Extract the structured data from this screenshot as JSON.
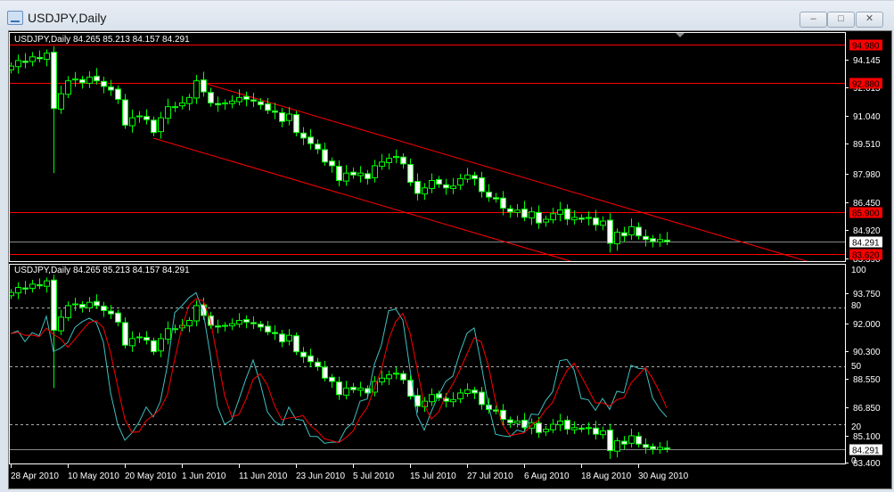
{
  "window": {
    "title": "USDJPY,Daily",
    "minimize": "–",
    "restore": "□",
    "close": "✕"
  },
  "colors": {
    "bull_outline": "#00ff00",
    "bear_body": "#ffffff",
    "level": "#ff0000",
    "stoch_main": "#40c0c0",
    "stoch_signal": "#ff0000"
  },
  "upper_panel": {
    "header": "USDJPY,Daily  84.265 85.213 84.157 84.291",
    "price_ticks": [
      "94.145",
      "92.615",
      "91.040",
      "89.510",
      "87.980",
      "86.450",
      "84.920",
      "83.390"
    ],
    "levels": [
      {
        "label": "94.980",
        "price": 94.98
      },
      {
        "label": "92.880",
        "price": 92.88
      },
      {
        "label": "85.900",
        "price": 85.9
      },
      {
        "label": "83.620",
        "price": 83.62
      }
    ],
    "current_price": "84.291"
  },
  "lower_panel": {
    "header": "USDJPY,Daily  84.265 85.213 84.157 84.291",
    "price_ticks": [
      "93.750",
      "92.000",
      "90.300",
      "88.550",
      "86.850",
      "85.100",
      "83.400"
    ],
    "stoch_ticks": [
      "100",
      "80",
      "50",
      "20",
      "0"
    ],
    "current_price": "84.291"
  },
  "date_axis": [
    "28 Apr 2010",
    "10 May 2010",
    "20 May 2010",
    "1 Jun 2010",
    "11 Jun 2010",
    "23 Jun 2010",
    "5 Jul 2010",
    "15 Jul 2010",
    "27 Jul 2010",
    "6 Aug 2010",
    "18 Aug 2010",
    "30 Aug 2010"
  ],
  "chart_data": {
    "type": "candlestick",
    "symbol": "USDJPY",
    "timeframe": "Daily",
    "closes": [
      93.8,
      94.1,
      94.0,
      94.3,
      94.2,
      94.5,
      91.5,
      92.3,
      93.0,
      93.1,
      92.9,
      93.2,
      93.0,
      92.7,
      92.5,
      92.0,
      90.6,
      91.0,
      91.1,
      90.9,
      90.2,
      91.0,
      91.6,
      91.6,
      91.8,
      92.1,
      93.0,
      92.4,
      91.8,
      91.7,
      91.8,
      91.9,
      92.1,
      92.0,
      91.9,
      91.7,
      91.4,
      91.3,
      90.8,
      91.2,
      90.2,
      89.9,
      89.6,
      89.3,
      88.6,
      88.4,
      87.6,
      88.0,
      87.9,
      88.0,
      87.7,
      88.4,
      88.6,
      88.8,
      88.9,
      88.5,
      87.5,
      86.9,
      87.2,
      87.6,
      87.4,
      87.2,
      87.3,
      87.7,
      87.9,
      87.7,
      87.0,
      86.7,
      86.6,
      86.1,
      85.9,
      86.0,
      85.6,
      85.9,
      85.3,
      85.5,
      85.8,
      86.0,
      85.5,
      85.6,
      85.5,
      85.6,
      85.2,
      85.4,
      84.2,
      84.8,
      84.6,
      85.1,
      84.6,
      84.4,
      84.3,
      84.4,
      84.291
    ],
    "channel": {
      "upper_from": 92.88,
      "lower_from": 90.2
    },
    "stochastic": {
      "k": 5,
      "d": 3,
      "slowing": 3,
      "levels": [
        80,
        50,
        20
      ]
    }
  }
}
